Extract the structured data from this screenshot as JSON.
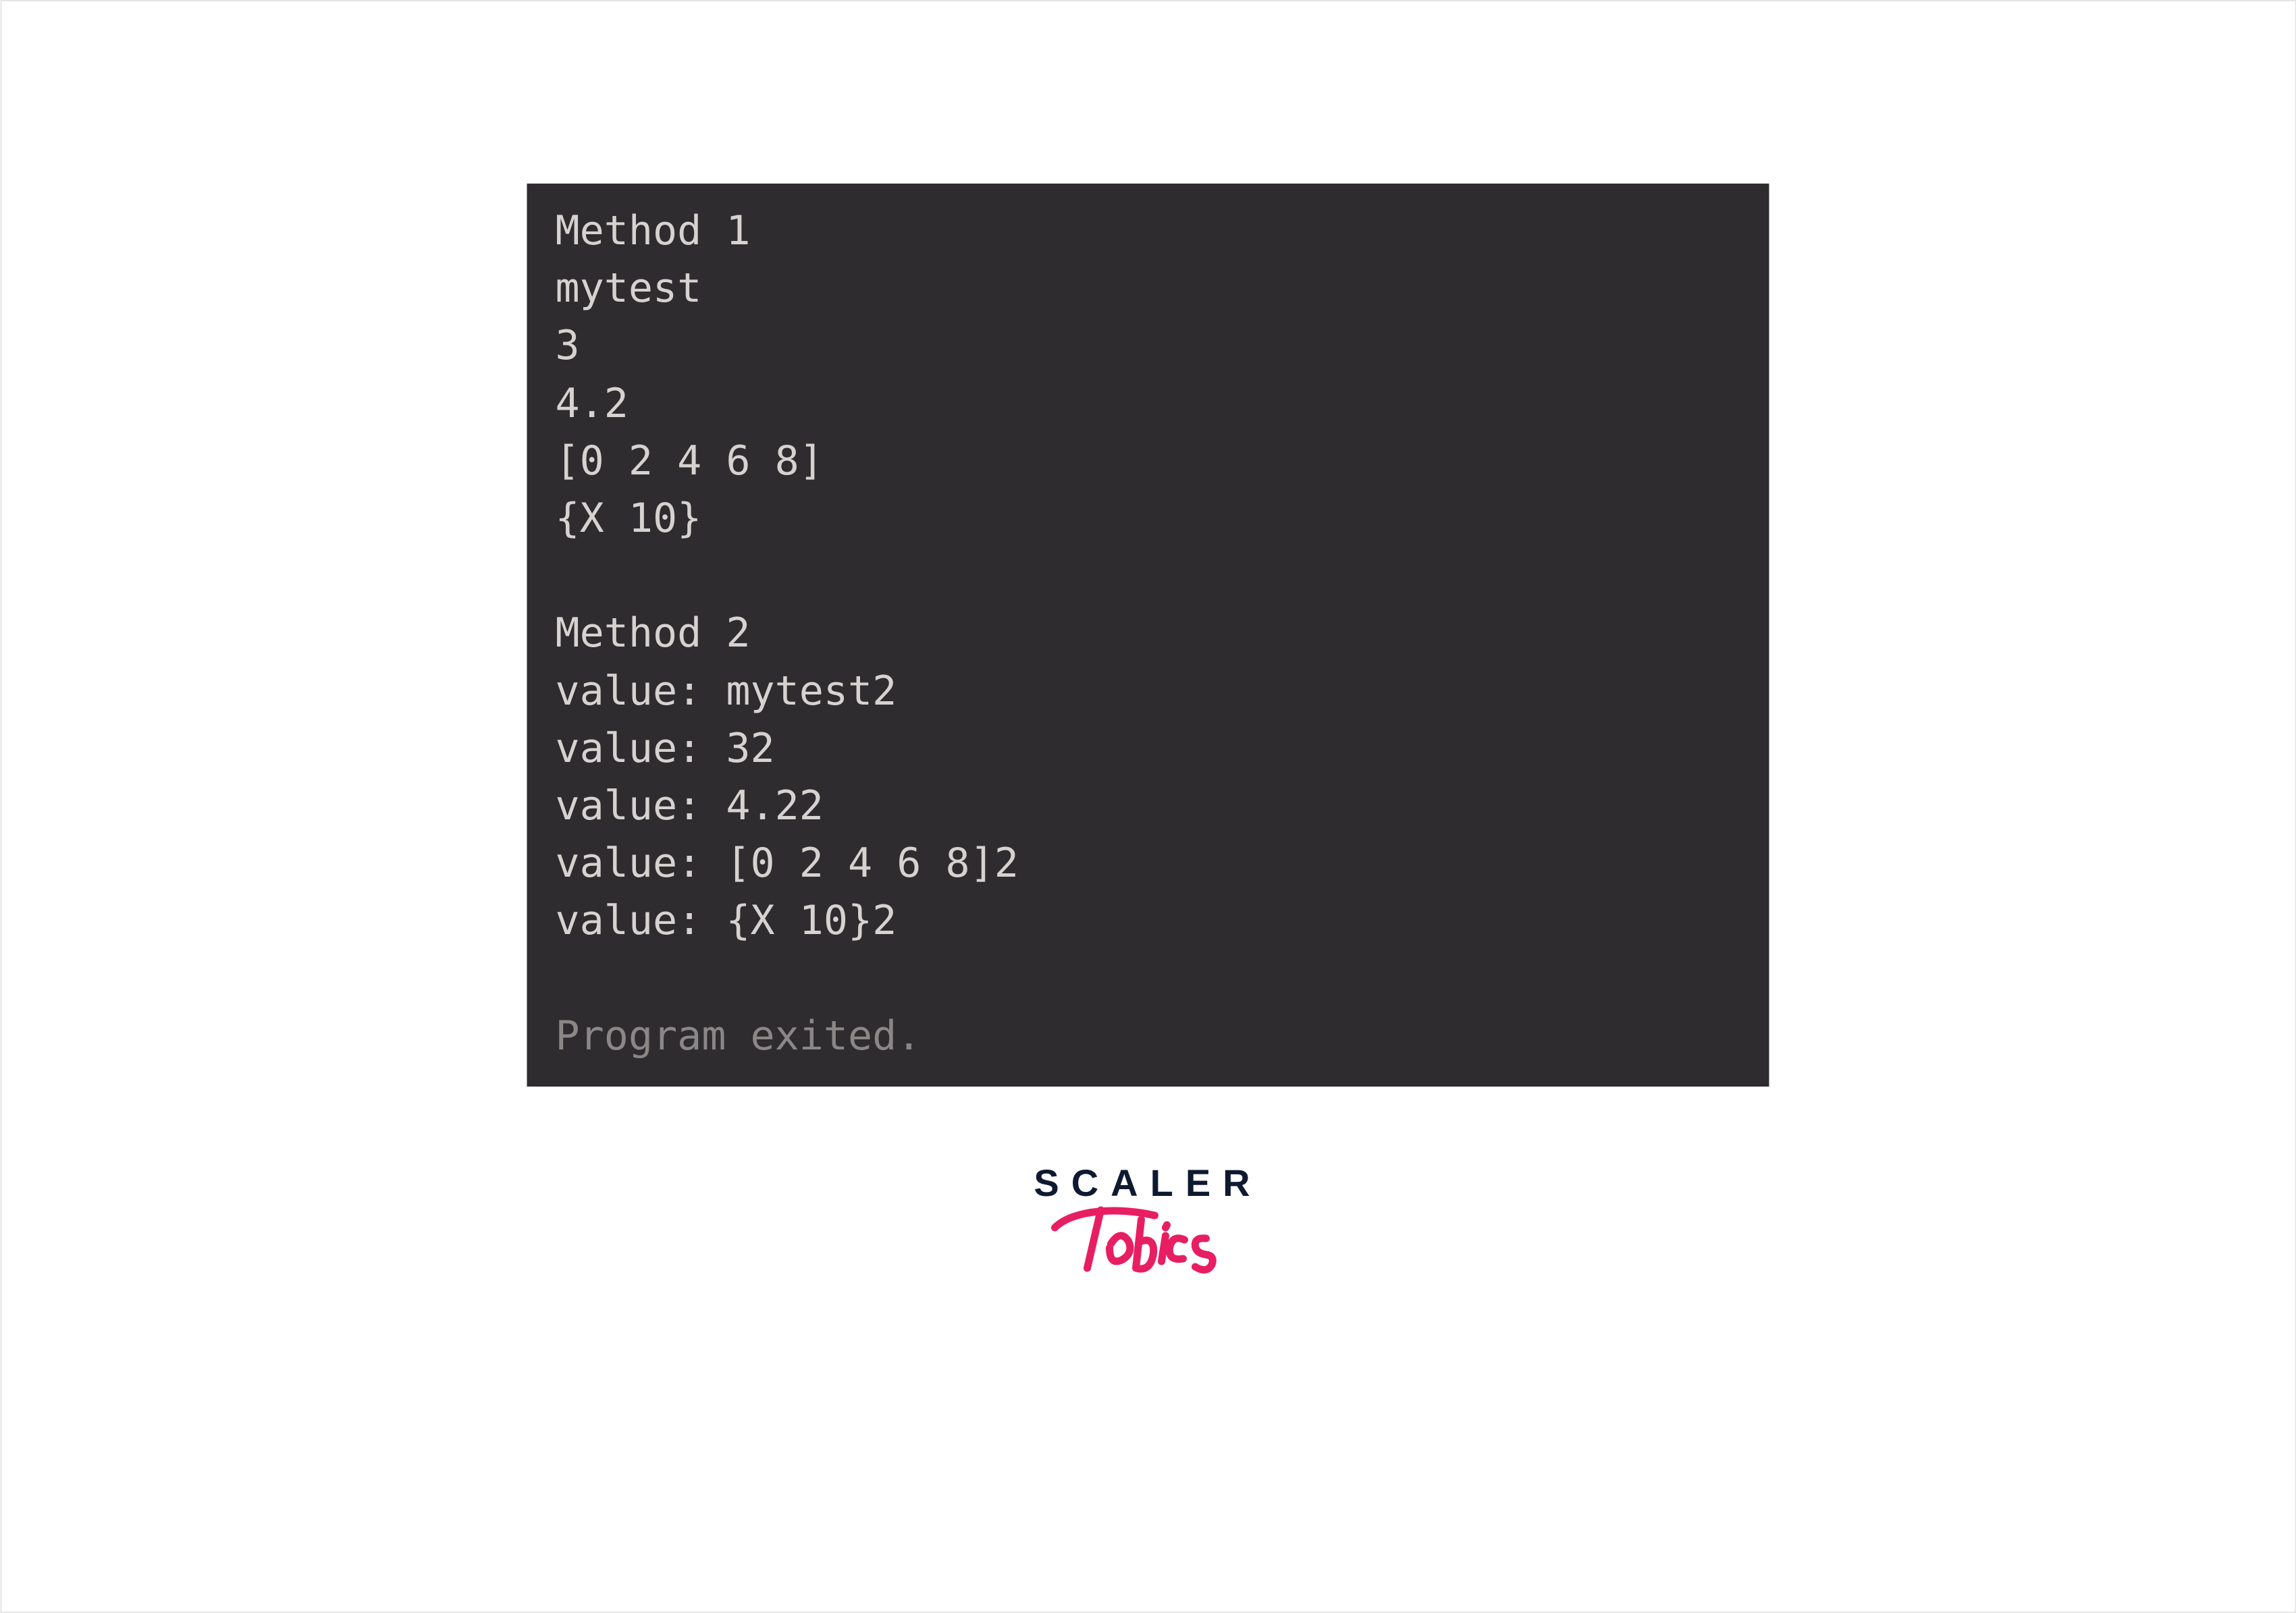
{
  "terminal": {
    "lines": [
      "Method 1",
      "mytest",
      "3",
      "4.2",
      "[0 2 4 6 8]",
      "{X 10}",
      "",
      "Method 2",
      "value: mytest2",
      "value: 32",
      "value: 4.22",
      "value: [0 2 4 6 8]2",
      "value: {X 10}2",
      ""
    ],
    "exit_line": "Program exited."
  },
  "logo": {
    "word": "SCALER",
    "sub": "Topics"
  }
}
